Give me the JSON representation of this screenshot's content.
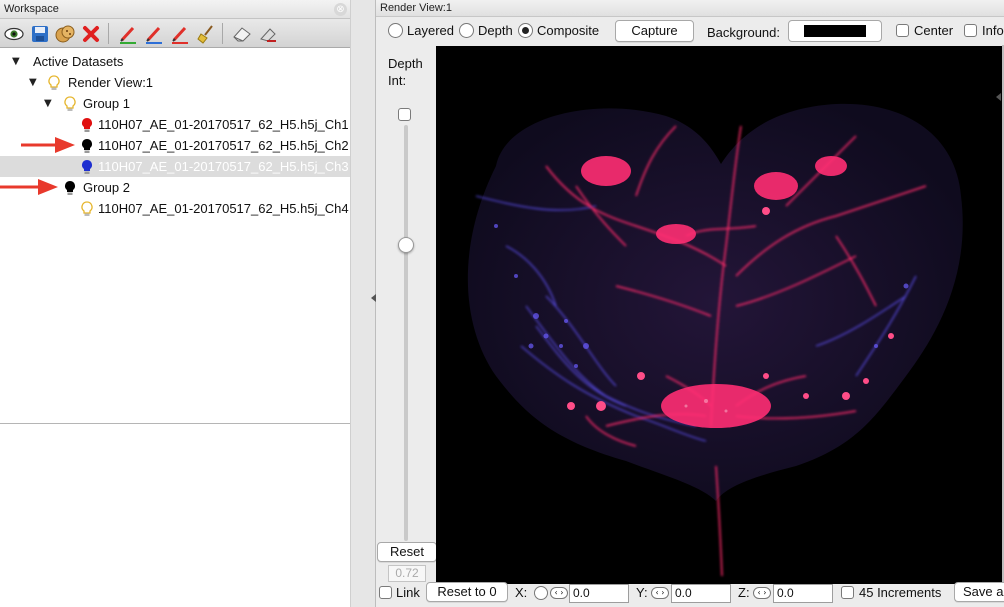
{
  "workspace": {
    "title": "Workspace",
    "close_glyph": "⊗",
    "toolbar": [
      {
        "icon": "eye-icon"
      },
      {
        "icon": "save-icon"
      },
      {
        "icon": "cookies-icon"
      },
      {
        "icon": "delete-x-icon"
      },
      {
        "icon": "red-pen-icon"
      },
      {
        "icon": "blue-pen-icon"
      },
      {
        "icon": "red-pencil-icon"
      },
      {
        "icon": "broom-icon"
      },
      {
        "icon": "eraser-icon"
      },
      {
        "icon": "clear-icon"
      }
    ],
    "tree": {
      "root": "Active Datasets",
      "render_view": "Render View:1",
      "group1": "Group 1",
      "ch1": "110H07_AE_01-20170517_62_H5.h5j_Ch1",
      "ch2": "110H07_AE_01-20170517_62_H5.h5j_Ch2",
      "ch3": "110H07_AE_01-20170517_62_H5.h5j_Ch3",
      "group2": "Group 2",
      "ch4": "110H07_AE_01-20170517_62_H5.h5j_Ch4",
      "toggle_glyph": "▼"
    },
    "colors": {
      "ch1": "#e01010",
      "ch2": "#000000",
      "ch3": "#1e2fd0",
      "group2": "#000000",
      "bulb_off": "#f5d24a",
      "arrow": "#e8392c"
    }
  },
  "render_view": {
    "title": "Render View:1",
    "modes": [
      "Layered",
      "Depth",
      "Composite"
    ],
    "selected_mode": "Composite",
    "capture_label": "Capture",
    "background_label": "Background:",
    "background_color": "#000000",
    "center_label": "Center",
    "info_label": "Info",
    "depth_label_1": "Depth",
    "depth_label_2": "Int:",
    "reset_label": "Reset",
    "depth_value": "0.72",
    "bottom": {
      "link_label": "Link",
      "reset0_label": "Reset to 0",
      "x_label": "X:",
      "x_value": "0.0",
      "y_label": "Y:",
      "y_value": "0.0",
      "z_label": "Z:",
      "z_value": "0.0",
      "increments_label": "45 Increments",
      "save_label": "Save a",
      "stepper_glyph": "‹ ›"
    }
  },
  "image_colors": {
    "magenta": "#ff2a6a",
    "violet": "#7a55ff",
    "blue": "#3b3bd8",
    "tissue": "#1a1330"
  }
}
